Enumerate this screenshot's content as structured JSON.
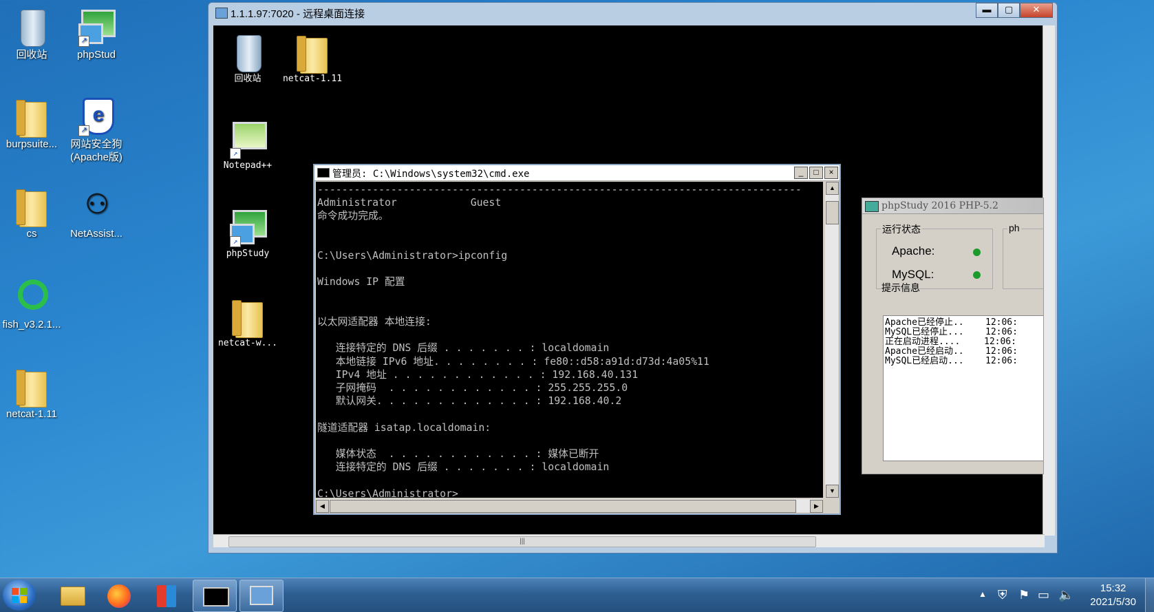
{
  "desktop": {
    "icons": [
      {
        "label": "回收站"
      },
      {
        "label": "phpStud"
      },
      {
        "label": "burpsuite..."
      },
      {
        "label": "网站安全狗(Apache版)"
      },
      {
        "label": "cs"
      },
      {
        "label": "NetAssist..."
      },
      {
        "label": "fish_v3.2.1..."
      },
      {
        "label": "netcat-1.11"
      }
    ]
  },
  "rdp_window": {
    "title": "1.1.1.97:7020 - 远程桌面连接",
    "buttons": {
      "minimize": "▬",
      "maximize": "▢",
      "close": "✕"
    },
    "remote_icons": [
      {
        "label": "回收站"
      },
      {
        "label": "netcat-1.11"
      },
      {
        "label": "Notepad++"
      },
      {
        "label": "phpStudy"
      },
      {
        "label": "netcat-w..."
      }
    ]
  },
  "cmd_window": {
    "title": "管理员: C:\\Windows\\system32\\cmd.exe",
    "buttons": {
      "minimize": "_",
      "maximize": "□",
      "close": "×"
    },
    "output": "-------------------------------------------------------------------------------\nAdministrator            Guest\n命令成功完成。\n\n\nC:\\Users\\Administrator>ipconfig\n\nWindows IP 配置\n\n\n以太网适配器 本地连接:\n\n   连接特定的 DNS 后缀 . . . . . . . : localdomain\n   本地链接 IPv6 地址. . . . . . . . : fe80::d58:a91d:d73d:4a05%11\n   IPv4 地址 . . . . . . . . . . . . : 192.168.40.131\n   子网掩码  . . . . . . . . . . . . : 255.255.255.0\n   默认网关. . . . . . . . . . . . . : 192.168.40.2\n\n隧道适配器 isatap.localdomain:\n\n   媒体状态  . . . . . . . . . . . . : 媒体已断开\n   连接特定的 DNS 后缀 . . . . . . . : localdomain\n\nC:\\Users\\Administrator>_"
  },
  "phpstudy": {
    "title": "phpStudy 2016   PHP-5.2",
    "group_run": "运行状态",
    "group_right": "ph",
    "apache_label": "Apache:",
    "mysql_label": "MySQL:",
    "status_color": "#1c9a2c",
    "group_info": "提示信息",
    "log": [
      {
        "msg": "Apache已经停止..",
        "time": "12:06:"
      },
      {
        "msg": "MySQL已经停止...",
        "time": "12:06:"
      },
      {
        "msg": "正在启动进程....",
        "time": "12:06:"
      },
      {
        "msg": "Apache已经启动..",
        "time": "12:06:"
      },
      {
        "msg": "MySQL已经启动...",
        "time": "12:06:"
      }
    ]
  },
  "taskbar": {
    "time": "15:32",
    "date": "2021/5/30"
  }
}
